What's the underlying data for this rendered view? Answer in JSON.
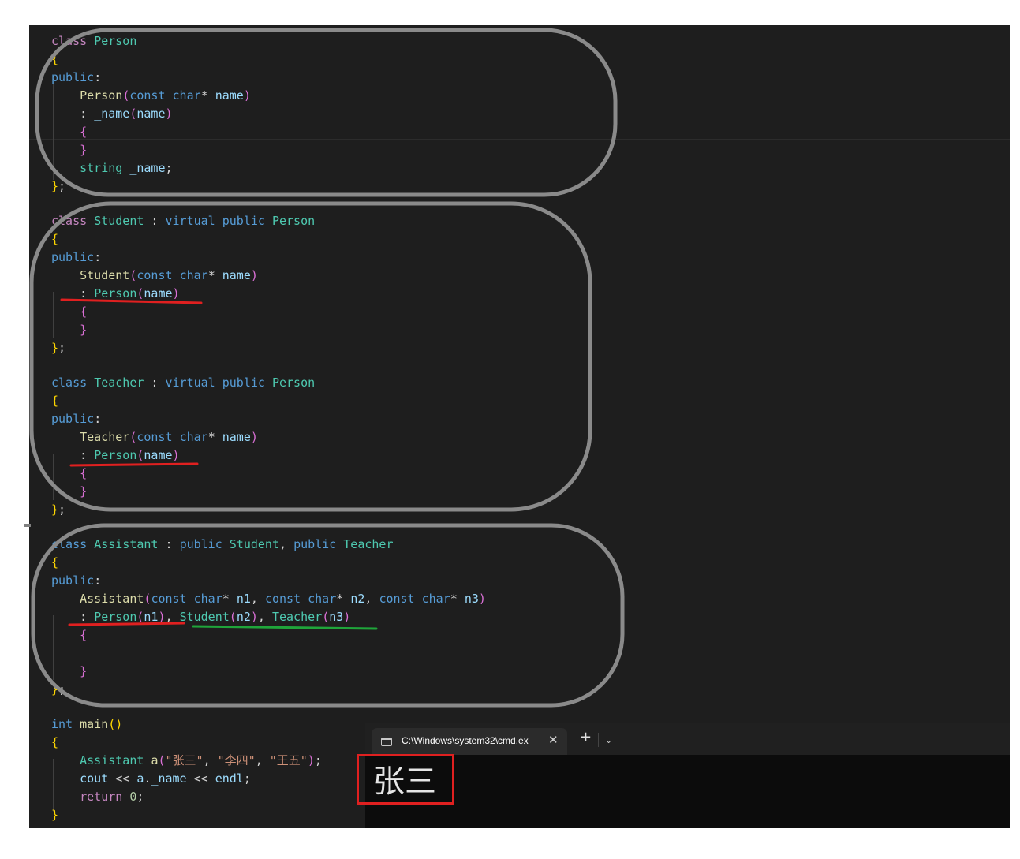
{
  "editor": {
    "lines": [
      [
        [
          "ctl",
          "class"
        ],
        [
          "plain",
          " "
        ],
        [
          "ty",
          "Person"
        ]
      ],
      [
        [
          "b1",
          "{"
        ]
      ],
      [
        [
          "kw",
          "public"
        ],
        [
          "plain",
          ":"
        ]
      ],
      [
        [
          "plain",
          "    "
        ],
        [
          "fn",
          "Person"
        ],
        [
          "b2",
          "("
        ],
        [
          "kw",
          "const"
        ],
        [
          "plain",
          " "
        ],
        [
          "kw",
          "char"
        ],
        [
          "plain",
          "* "
        ],
        [
          "var",
          "name"
        ],
        [
          "b2",
          ")"
        ]
      ],
      [
        [
          "plain",
          "    : "
        ],
        [
          "var",
          "_name"
        ],
        [
          "b2",
          "("
        ],
        [
          "var",
          "name"
        ],
        [
          "b2",
          ")"
        ]
      ],
      [
        [
          "plain",
          "    "
        ],
        [
          "b2",
          "{"
        ]
      ],
      [
        [
          "plain",
          "    "
        ],
        [
          "b2",
          "}"
        ]
      ],
      [
        [
          "plain",
          "    "
        ],
        [
          "ty",
          "string"
        ],
        [
          "plain",
          " "
        ],
        [
          "var",
          "_name"
        ],
        [
          "plain",
          ";"
        ]
      ],
      [
        [
          "b1",
          "}"
        ],
        [
          "plain",
          ";"
        ]
      ],
      [],
      [
        [
          "ctl",
          "class"
        ],
        [
          "plain",
          " "
        ],
        [
          "ty",
          "Student"
        ],
        [
          "plain",
          " : "
        ],
        [
          "kw",
          "virtual"
        ],
        [
          "plain",
          " "
        ],
        [
          "kw",
          "public"
        ],
        [
          "plain",
          " "
        ],
        [
          "ty",
          "Person"
        ]
      ],
      [
        [
          "b1",
          "{"
        ]
      ],
      [
        [
          "kw",
          "public"
        ],
        [
          "plain",
          ":"
        ]
      ],
      [
        [
          "plain",
          "    "
        ],
        [
          "fn",
          "Student"
        ],
        [
          "b2",
          "("
        ],
        [
          "kw",
          "const"
        ],
        [
          "plain",
          " "
        ],
        [
          "kw",
          "char"
        ],
        [
          "plain",
          "* "
        ],
        [
          "var",
          "name"
        ],
        [
          "b2",
          ")"
        ]
      ],
      [
        [
          "plain",
          "    : "
        ],
        [
          "ty",
          "Person"
        ],
        [
          "b2",
          "("
        ],
        [
          "var",
          "name"
        ],
        [
          "b2",
          ")"
        ]
      ],
      [
        [
          "plain",
          "    "
        ],
        [
          "b2",
          "{"
        ]
      ],
      [
        [
          "plain",
          "    "
        ],
        [
          "b2",
          "}"
        ]
      ],
      [
        [
          "b1",
          "}"
        ],
        [
          "plain",
          ";"
        ]
      ],
      [],
      [
        [
          "kw",
          "class"
        ],
        [
          "plain",
          " "
        ],
        [
          "ty",
          "Teacher"
        ],
        [
          "plain",
          " : "
        ],
        [
          "kw",
          "virtual"
        ],
        [
          "plain",
          " "
        ],
        [
          "kw",
          "public"
        ],
        [
          "plain",
          " "
        ],
        [
          "ty",
          "Person"
        ]
      ],
      [
        [
          "b1",
          "{"
        ]
      ],
      [
        [
          "kw",
          "public"
        ],
        [
          "plain",
          ":"
        ]
      ],
      [
        [
          "plain",
          "    "
        ],
        [
          "fn",
          "Teacher"
        ],
        [
          "b2",
          "("
        ],
        [
          "kw",
          "const"
        ],
        [
          "plain",
          " "
        ],
        [
          "kw",
          "char"
        ],
        [
          "plain",
          "* "
        ],
        [
          "var",
          "name"
        ],
        [
          "b2",
          ")"
        ]
      ],
      [
        [
          "plain",
          "    : "
        ],
        [
          "ty",
          "Person"
        ],
        [
          "b2",
          "("
        ],
        [
          "var",
          "name"
        ],
        [
          "b2",
          ")"
        ]
      ],
      [
        [
          "plain",
          "    "
        ],
        [
          "b2",
          "{"
        ]
      ],
      [
        [
          "plain",
          "    "
        ],
        [
          "b2",
          "}"
        ]
      ],
      [
        [
          "b1",
          "}"
        ],
        [
          "plain",
          ";"
        ]
      ],
      [],
      [
        [
          "kw",
          "class"
        ],
        [
          "plain",
          " "
        ],
        [
          "ty",
          "Assistant"
        ],
        [
          "plain",
          " : "
        ],
        [
          "kw",
          "public"
        ],
        [
          "plain",
          " "
        ],
        [
          "ty",
          "Student"
        ],
        [
          "plain",
          ", "
        ],
        [
          "kw",
          "public"
        ],
        [
          "plain",
          " "
        ],
        [
          "ty",
          "Teacher"
        ]
      ],
      [
        [
          "b1",
          "{"
        ]
      ],
      [
        [
          "kw",
          "public"
        ],
        [
          "plain",
          ":"
        ]
      ],
      [
        [
          "plain",
          "    "
        ],
        [
          "fn",
          "Assistant"
        ],
        [
          "b2",
          "("
        ],
        [
          "kw",
          "const"
        ],
        [
          "plain",
          " "
        ],
        [
          "kw",
          "char"
        ],
        [
          "plain",
          "* "
        ],
        [
          "var",
          "n1"
        ],
        [
          "plain",
          ", "
        ],
        [
          "kw",
          "const"
        ],
        [
          "plain",
          " "
        ],
        [
          "kw",
          "char"
        ],
        [
          "plain",
          "* "
        ],
        [
          "var",
          "n2"
        ],
        [
          "plain",
          ", "
        ],
        [
          "kw",
          "const"
        ],
        [
          "plain",
          " "
        ],
        [
          "kw",
          "char"
        ],
        [
          "plain",
          "* "
        ],
        [
          "var",
          "n3"
        ],
        [
          "b2",
          ")"
        ]
      ],
      [
        [
          "plain",
          "    : "
        ],
        [
          "ty",
          "Person"
        ],
        [
          "b2",
          "("
        ],
        [
          "var",
          "n1"
        ],
        [
          "b2",
          ")"
        ],
        [
          "plain",
          ", "
        ],
        [
          "ty",
          "Student"
        ],
        [
          "b2",
          "("
        ],
        [
          "var",
          "n2"
        ],
        [
          "b2",
          ")"
        ],
        [
          "plain",
          ", "
        ],
        [
          "ty",
          "Teacher"
        ],
        [
          "b2",
          "("
        ],
        [
          "var",
          "n3"
        ],
        [
          "b2",
          ")"
        ]
      ],
      [
        [
          "plain",
          "    "
        ],
        [
          "b2",
          "{"
        ]
      ],
      [],
      [
        [
          "plain",
          "    "
        ],
        [
          "b2",
          "}"
        ]
      ],
      [
        [
          "b1",
          "}"
        ],
        [
          "plain",
          ";"
        ]
      ],
      [],
      [
        [
          "kw",
          "int"
        ],
        [
          "plain",
          " "
        ],
        [
          "fn",
          "main"
        ],
        [
          "b1",
          "()"
        ]
      ],
      [
        [
          "b1",
          "{"
        ]
      ],
      [
        [
          "plain",
          "    "
        ],
        [
          "ty",
          "Assistant"
        ],
        [
          "plain",
          " "
        ],
        [
          "fn",
          "a"
        ],
        [
          "b2",
          "("
        ],
        [
          "str",
          "\"张三\""
        ],
        [
          "plain",
          ", "
        ],
        [
          "str",
          "\"李四\""
        ],
        [
          "plain",
          ", "
        ],
        [
          "str",
          "\"王五\""
        ],
        [
          "b2",
          ")"
        ],
        [
          "plain",
          ";"
        ]
      ],
      [
        [
          "plain",
          "    "
        ],
        [
          "var",
          "cout"
        ],
        [
          "plain",
          " << "
        ],
        [
          "var",
          "a"
        ],
        [
          "plain",
          "."
        ],
        [
          "var",
          "_name"
        ],
        [
          "plain",
          " << "
        ],
        [
          "var",
          "endl"
        ],
        [
          "plain",
          ";"
        ]
      ],
      [
        [
          "plain",
          "    "
        ],
        [
          "ctl",
          "return"
        ],
        [
          "plain",
          " "
        ],
        [
          "num",
          "0"
        ],
        [
          "plain",
          ";"
        ]
      ],
      [
        [
          "b1",
          "}"
        ]
      ]
    ]
  },
  "terminal": {
    "tab_title": "C:\\Windows\\system32\\cmd.ex",
    "close_glyph": "✕",
    "new_tab_glyph": "+",
    "dropdown_glyph": "⌄",
    "output": "张三",
    "icon": "terminal-icon"
  },
  "annotations": {
    "box_color": "#8a8a8a",
    "red_underline_color": "#e02020",
    "green_underline_color": "#1fa53a",
    "output_box_color": "#e02020"
  }
}
